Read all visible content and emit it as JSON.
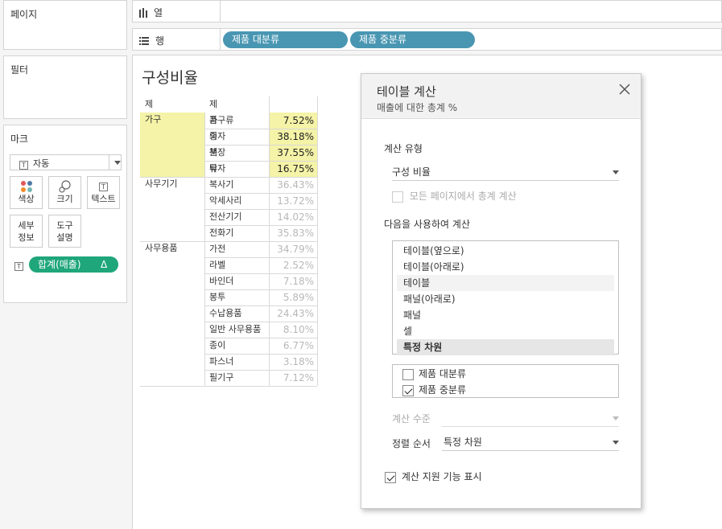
{
  "left_panel": {
    "pages": {
      "title": "페이지"
    },
    "filters": {
      "title": "필터"
    },
    "marks": {
      "title": "마크",
      "type_select": "자동",
      "buttons": {
        "color": "색상",
        "size": "크기",
        "text": "텍스트",
        "detail_line1": "세부",
        "detail_line2": "정보",
        "tooltip_line1": "도구",
        "tooltip_line2": "설명"
      },
      "measure_pill": {
        "label": "합계(매출)",
        "delta": "Δ",
        "icon": "text-icon"
      }
    }
  },
  "shelves": {
    "columns": {
      "label": "열",
      "icon": "columns-icon"
    },
    "rows": {
      "label": "행",
      "icon": "rows-icon",
      "pills": [
        "제품 대분류",
        "제품 중분류"
      ]
    }
  },
  "viz": {
    "title": "구성비율",
    "col_headers": [
      "제품 대분류",
      "제품 중분류"
    ],
    "groups": [
      {
        "name": "가구",
        "highlight": true,
        "items": [
          {
            "sub": "가구류",
            "value": "7.52%"
          },
          {
            "sub": "의자",
            "value": "38.18%"
          },
          {
            "sub": "책장",
            "value": "37.55%"
          },
          {
            "sub": "탁자",
            "value": "16.75%"
          }
        ]
      },
      {
        "name": "사무기기",
        "highlight": false,
        "items": [
          {
            "sub": "복사기",
            "value": "36.43%"
          },
          {
            "sub": "악세사리",
            "value": "13.72%"
          },
          {
            "sub": "전산기기",
            "value": "14.02%"
          },
          {
            "sub": "전화기",
            "value": "35.83%"
          }
        ]
      },
      {
        "name": "사무용품",
        "highlight": false,
        "items": [
          {
            "sub": "가전",
            "value": "34.79%"
          },
          {
            "sub": "라벨",
            "value": "2.52%"
          },
          {
            "sub": "바인더",
            "value": "7.18%"
          },
          {
            "sub": "봉투",
            "value": "5.89%"
          },
          {
            "sub": "수납용품",
            "value": "24.43%"
          },
          {
            "sub": "일반 사무용품",
            "value": "8.10%"
          },
          {
            "sub": "종이",
            "value": "6.77%"
          },
          {
            "sub": "파스너",
            "value": "3.18%"
          },
          {
            "sub": "필기구",
            "value": "7.12%"
          }
        ]
      }
    ],
    "colors": {
      "highlight": "#f4f3a7",
      "faded_text": "#b8b8b8",
      "pill": "#4996b2",
      "measure_pill": "#1fa67a"
    }
  },
  "dialog": {
    "title": "테이블 계산",
    "subtitle": "매출에 대한 총계 %",
    "calc_type_label": "계산 유형",
    "calc_type_value": "구성 비율",
    "all_pages_label": "모든 페이지에서 총계 계산",
    "compute_using_label": "다음을 사용하여 계산",
    "compute_options": [
      "테이블(옆으로)",
      "테이블(아래로)",
      "테이블",
      "패널(아래로)",
      "패널",
      "셀",
      "특정 차원"
    ],
    "dimensions": [
      {
        "label": "제품 대분류",
        "checked": false
      },
      {
        "label": "제품 중분류",
        "checked": true
      }
    ],
    "level_label": "계산 수준",
    "sort_label": "정렬 순서",
    "sort_value": "특정 차원",
    "show_assist_label": "계산 지원 기능 표시",
    "close_icon": "close-icon"
  }
}
